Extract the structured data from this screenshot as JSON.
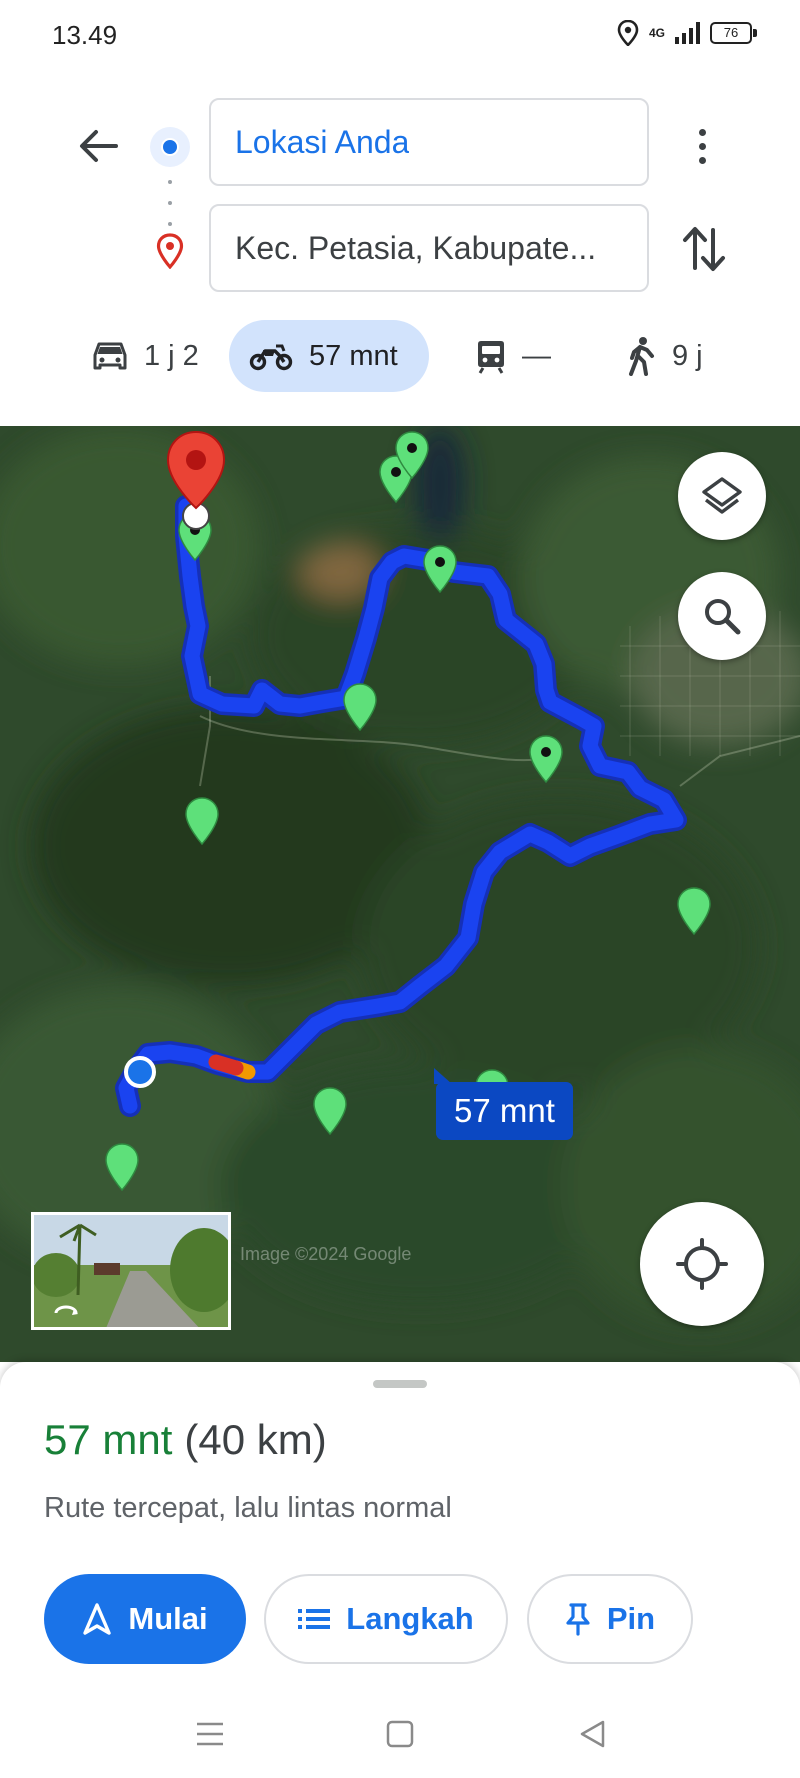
{
  "status_bar": {
    "time": "13.49",
    "network": "4G",
    "battery": "76"
  },
  "route": {
    "origin": "Lokasi Anda",
    "destination": "Kec. Petasia, Kabupate..."
  },
  "modes": [
    {
      "name": "car",
      "label": "1 j 2"
    },
    {
      "name": "motorcycle",
      "label": "57 mnt",
      "selected": true
    },
    {
      "name": "transit",
      "label": "—"
    },
    {
      "name": "walk",
      "label": "9 j"
    }
  ],
  "map": {
    "eta_label": "57 mnt",
    "watermark": "Image ©2024 Google"
  },
  "summary": {
    "time": "57 mnt",
    "distance": "(40 km)",
    "description": "Rute tercepat, lalu lintas normal"
  },
  "actions": {
    "start": "Mulai",
    "steps": "Langkah",
    "pin": "Pin"
  },
  "colors": {
    "accent": "#1a73e8",
    "route": "#1a43f0",
    "eta_green": "#188038",
    "selected_mode_bg": "#d2e3fc"
  }
}
